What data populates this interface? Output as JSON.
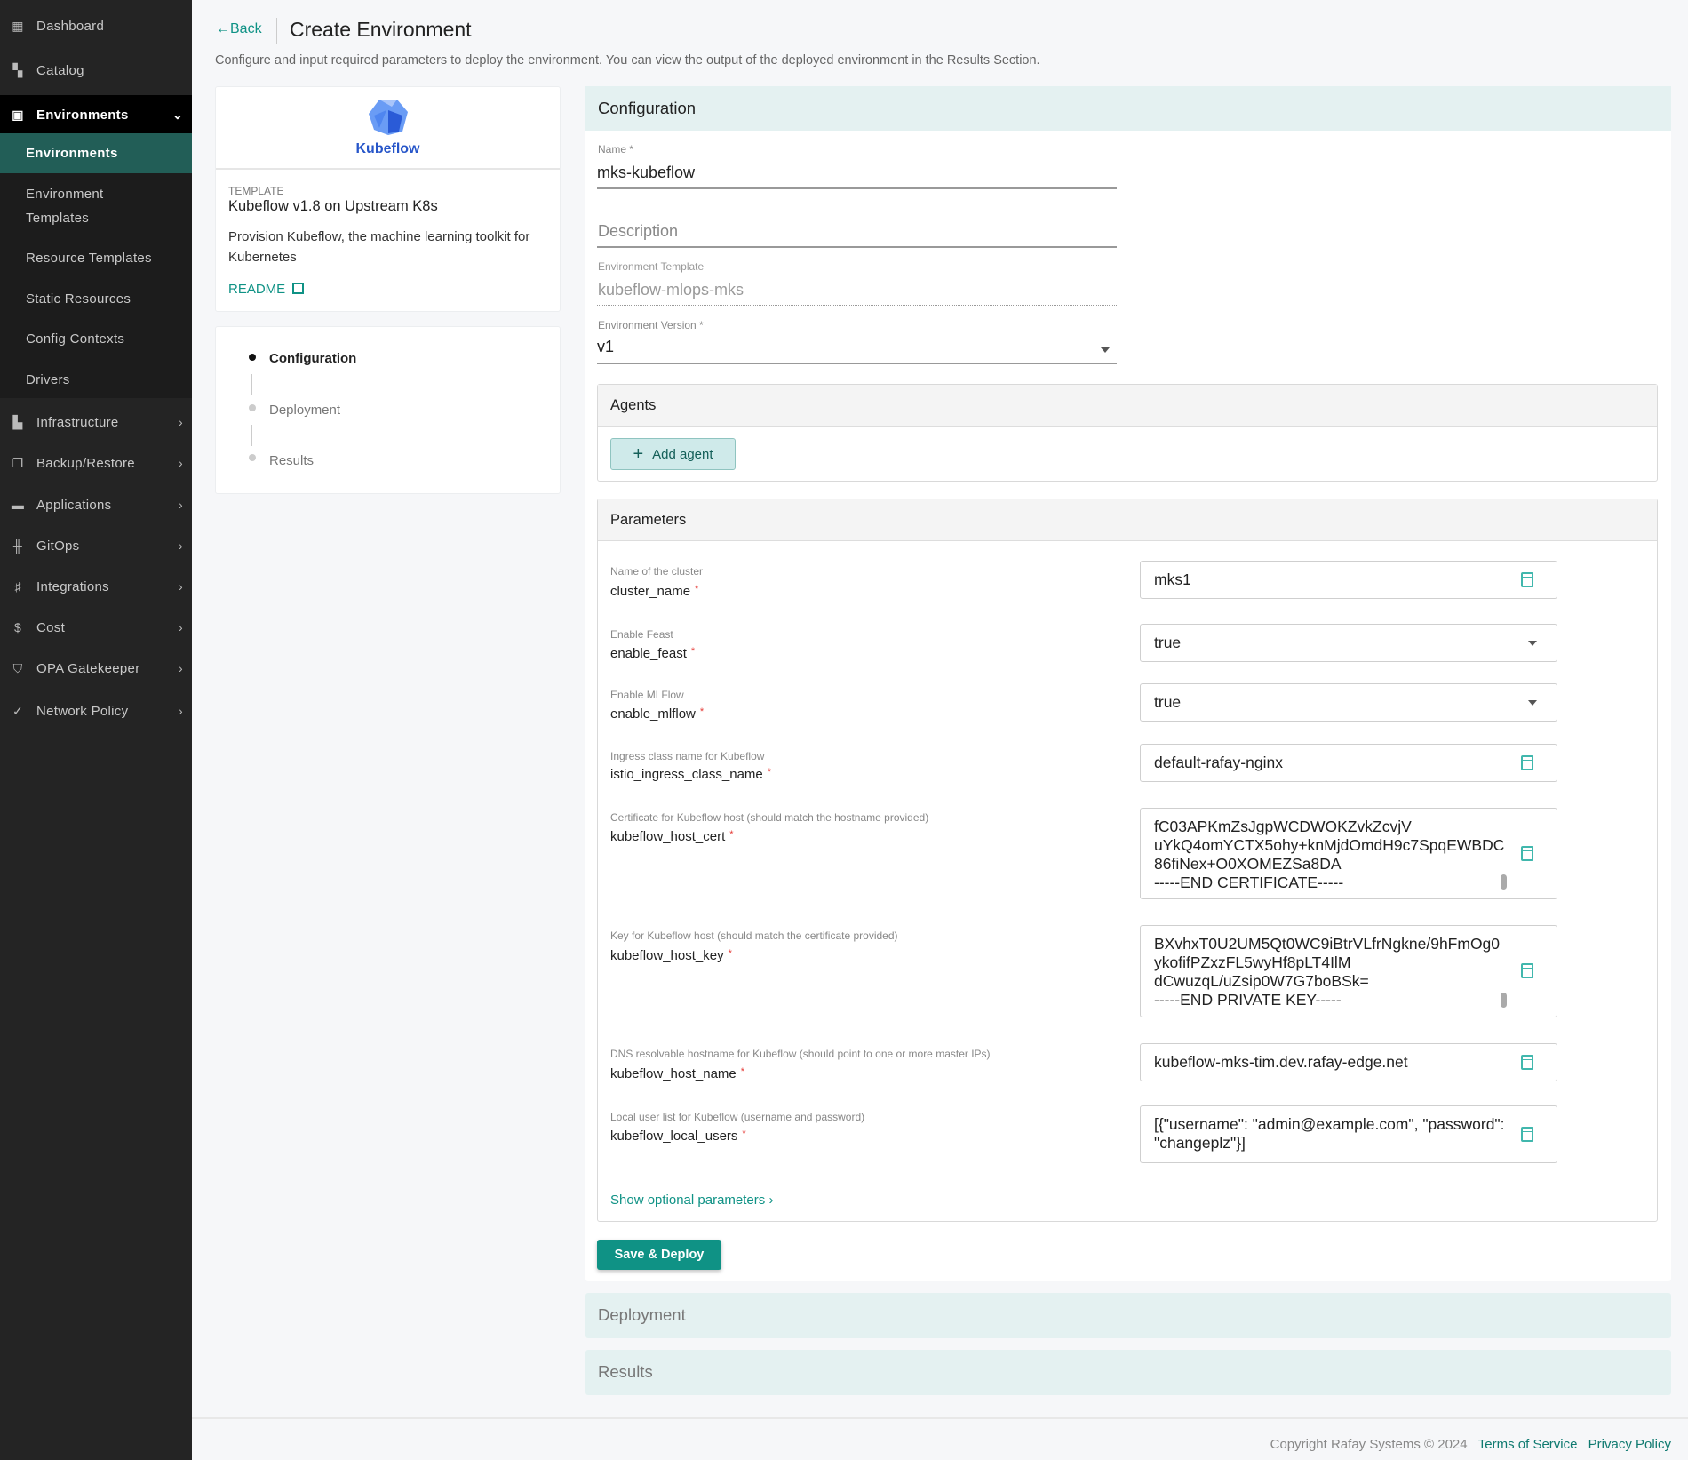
{
  "sidebar": {
    "top_items": [
      {
        "label": "Dashboard",
        "icon": "dashboard-icon"
      },
      {
        "label": "Catalog",
        "icon": "catalog-icon"
      }
    ],
    "expanded": {
      "label": "Environments",
      "icon": "environments-icon",
      "children": [
        "Environments",
        "Environment Templates",
        "Resource Templates",
        "Static Resources",
        "Config Contexts",
        "Drivers"
      ],
      "active": "Environments"
    },
    "items": [
      {
        "label": "Infrastructure",
        "icon": "building-icon"
      },
      {
        "label": "Backup/Restore",
        "icon": "backup-icon"
      },
      {
        "label": "Applications",
        "icon": "briefcase-icon"
      },
      {
        "label": "GitOps",
        "icon": "gitops-icon"
      },
      {
        "label": "Integrations",
        "icon": "integrations-icon"
      },
      {
        "label": "Cost",
        "icon": "dollar-icon"
      },
      {
        "label": "OPA Gatekeeper",
        "icon": "shield-icon"
      },
      {
        "label": "Network Policy",
        "icon": "shield-check-icon"
      }
    ]
  },
  "header": {
    "back": "Back",
    "title": "Create Environment",
    "subtitle": "Configure and input required parameters to deploy the environment. You can view the output of the deployed environment in the Results Section."
  },
  "template_card": {
    "logo_text": "Kubeflow",
    "label": "TEMPLATE",
    "name": "Kubeflow v1.8 on Upstream K8s",
    "description": "Provision Kubeflow, the machine learning toolkit for Kubernetes",
    "readme": "README"
  },
  "steps": [
    {
      "label": "Configuration",
      "active": true
    },
    {
      "label": "Deployment",
      "active": false
    },
    {
      "label": "Results",
      "active": false
    }
  ],
  "configuration": {
    "title": "Configuration",
    "name_label": "Name *",
    "name_value": "mks-kubeflow",
    "description_placeholder": "Description",
    "template_label": "Environment Template",
    "template_value": "kubeflow-mlops-mks",
    "version_label": "Environment Version *",
    "version_value": "v1",
    "agents_title": "Agents",
    "add_agent": "Add agent",
    "parameters_title": "Parameters",
    "parameters": [
      {
        "description": "Name of the cluster",
        "name": "cluster_name",
        "value": "mks1",
        "type": "text"
      },
      {
        "description": "Enable Feast",
        "name": "enable_feast",
        "value": "true",
        "type": "select"
      },
      {
        "description": "Enable MLFlow",
        "name": "enable_mlflow",
        "value": "true",
        "type": "select"
      },
      {
        "description": "Ingress class name for Kubeflow",
        "name": "istio_ingress_class_name",
        "value": "default-rafay-nginx",
        "type": "text"
      },
      {
        "description": "Certificate for Kubeflow host (should match the hostname provided)",
        "name": "kubeflow_host_cert",
        "value": "fC03APKmZsJgpWCDWOKZvkZcvjV\nuYkQ4omYCTX5ohy+knMjdOmdH9c7SpqEWBDC\n86fiNex+O0XOMEZSa8DA\n-----END CERTIFICATE-----",
        "type": "textarea"
      },
      {
        "description": "Key for Kubeflow host (should match the certificate provided)",
        "name": "kubeflow_host_key",
        "value": "BXvhxT0U2UM5Qt0WC9iBtrVLfrNgkne/9hFmOg0\nykofifPZxzFL5wyHf8pLT4IlM\ndCwuzqL/uZsip0W7G7boBSk=\n-----END PRIVATE KEY-----",
        "type": "textarea"
      },
      {
        "description": "DNS resolvable hostname for Kubeflow (should point to one or more master IPs)",
        "name": "kubeflow_host_name",
        "value": "kubeflow-mks-tim.dev.rafay-edge.net",
        "type": "text"
      },
      {
        "description": "Local user list for Kubeflow (username and password)",
        "name": "kubeflow_local_users",
        "value": "[{\"username\": \"admin@example.com\", \"password\":\n\"changeplz\"}]",
        "type": "textarea"
      }
    ],
    "required_mark": "*",
    "show_optional": "Show optional parameters",
    "save_deploy": "Save & Deploy"
  },
  "sections": {
    "deployment": "Deployment",
    "results": "Results"
  },
  "footer": {
    "copyright": "Copyright Rafay Systems © 2024",
    "terms": "Terms of Service",
    "privacy": "Privacy Policy"
  },
  "colors": {
    "accent": "#0f9285",
    "sidebar": "#242424",
    "active_nav": "#225e57",
    "section_band": "#e4f1f1"
  }
}
